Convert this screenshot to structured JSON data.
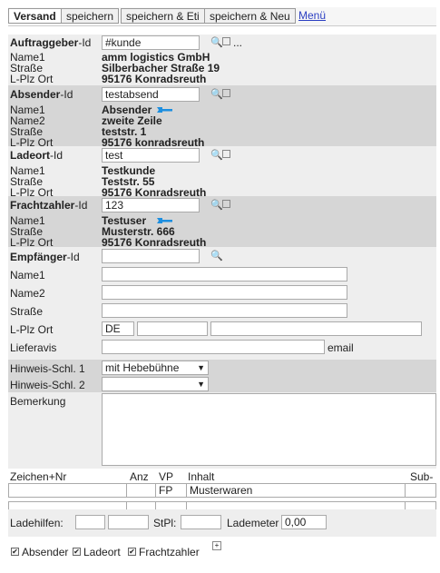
{
  "tabs": [
    "Versand",
    "speichern",
    "speichern & Eti",
    "speichern & Neu"
  ],
  "menu_label": "Menü",
  "auftraggeber": {
    "id_label": "Auftraggeber",
    "id_suffix": "-Id",
    "id_value": "#kunde",
    "more": "...",
    "rows": [
      {
        "label": "Name1",
        "value": "amm logistics GmbH"
      },
      {
        "label": "Straße",
        "value": "Silberbacher Straße 19"
      },
      {
        "label": "L-Plz Ort",
        "value": "95176 Konradsreuth"
      }
    ]
  },
  "absender": {
    "id_label": "Absender",
    "id_suffix": "-Id",
    "id_value": "testabsend",
    "rows": [
      {
        "label": "Name1",
        "value": "Absender"
      },
      {
        "label": "Name2",
        "value": "zweite Zeile"
      },
      {
        "label": "Straße",
        "value": "teststr. 1"
      },
      {
        "label": "L-Plz Ort",
        "value": "95176 konradsreuth"
      }
    ]
  },
  "ladeort": {
    "id_label": "Ladeort",
    "id_suffix": "-Id",
    "id_value": "test",
    "rows": [
      {
        "label": "Name1",
        "value": "Testkunde"
      },
      {
        "label": "Straße",
        "value": "Teststr. 55"
      },
      {
        "label": "L-Plz Ort",
        "value": "95176 Konradsreuth"
      }
    ]
  },
  "frachtzahler": {
    "id_label": "Frachtzahler",
    "id_suffix": "-Id",
    "id_value": "123",
    "rows": [
      {
        "label": "Name1",
        "value": "Testuser"
      },
      {
        "label": "Straße",
        "value": "Musterstr. 666"
      },
      {
        "label": "L-Plz Ort",
        "value": "95176 Konradsreuth"
      }
    ]
  },
  "empfaenger": {
    "id_label": "Empfänger",
    "id_suffix": "-Id",
    "id_value": "",
    "name1_label": "Name1",
    "name2_label": "Name2",
    "strasse_label": "Straße",
    "plz_label": "L-Plz Ort",
    "country_value": "DE",
    "lieferavis_label": "Lieferavis",
    "email_label": "email"
  },
  "hinweis1": {
    "label": "Hinweis-Schl. 1",
    "value": "mit Hebebühne"
  },
  "hinweis2": {
    "label": "Hinweis-Schl. 2",
    "value": ""
  },
  "bemerkung_label": "Bemerkung",
  "positions": {
    "headers": [
      "Zeichen+Nr",
      "Anz",
      "VP",
      "Inhalt",
      "Sub-"
    ],
    "rows": [
      {
        "zeichen": "",
        "anz": "",
        "vp": "FP",
        "inhalt": "Musterwaren"
      },
      {
        "zeichen": "",
        "anz": "",
        "vp": "",
        "inhalt": ""
      }
    ]
  },
  "ladehilfen": {
    "label": "Ladehilfen:",
    "stpl_label": "StPl:",
    "lademeter_label": "Lademeter",
    "lademeter_value": "0,00"
  },
  "checkboxes": [
    {
      "label": "Absender",
      "checked": true
    },
    {
      "label": "Ladeort",
      "checked": true
    },
    {
      "label": "Frachtzahler",
      "checked": true
    }
  ],
  "expand_symbol": "+",
  "colors": {
    "section_gray": "#d6d6d6",
    "link": "#2b3fc2",
    "icon": "#3a5fa8"
  }
}
